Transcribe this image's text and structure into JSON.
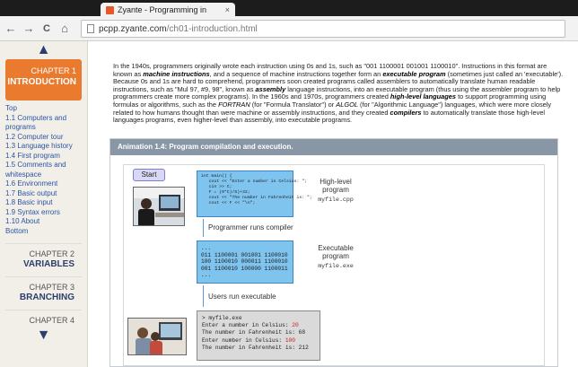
{
  "browser": {
    "tab_title": "Zyante - Programming in",
    "tab_close": "×",
    "back": "←",
    "forward": "→",
    "reload": "C",
    "home": "⌂",
    "url_host": "pcpp.zyante.com",
    "url_path": "/ch01-introduction.html"
  },
  "sidebar": {
    "up_arrow": "▲",
    "down_arrow": "▼",
    "active_chapter": {
      "label": "CHAPTER 1",
      "title": "INTRODUCTION"
    },
    "toc": [
      {
        "label": "Top",
        "sub": false
      },
      {
        "label": "1.1 Computers and programs",
        "sub": false
      },
      {
        "label": "1.2 Computer tour",
        "sub": false
      },
      {
        "label": "1.3 Language history",
        "sub": false
      },
      {
        "label": "1.4 First program",
        "sub": false
      },
      {
        "label": "1.5 Comments and whitespace",
        "sub": false
      },
      {
        "label": "1.6 Environment",
        "sub": false
      },
      {
        "label": "1.7 Basic output",
        "sub": false
      },
      {
        "label": "1.8 Basic input",
        "sub": false
      },
      {
        "label": "1.9 Syntax errors",
        "sub": false
      },
      {
        "label": "1.10 About",
        "sub": false
      },
      {
        "label": "Bottom",
        "sub": false
      }
    ],
    "chapters": [
      {
        "label": "CHAPTER 2",
        "title": "VARIABLES"
      },
      {
        "label": "CHAPTER 3",
        "title": "BRANCHING"
      },
      {
        "label": "CHAPTER 4",
        "title": ""
      }
    ]
  },
  "main": {
    "intro_segments": [
      {
        "t": "In the 1940s, programmers originally wrote each instruction using 0s and 1s, such as \"001 1100001 001001 1100010\". Instructions in this format are known as ",
        "s": ""
      },
      {
        "t": "machine instructions",
        "s": "bi"
      },
      {
        "t": ", and a sequence of machine instructions together form an ",
        "s": ""
      },
      {
        "t": "executable program",
        "s": "bi"
      },
      {
        "t": " (sometimes just called an 'executable'). Because 0s and 1s are hard to comprehend, programmers soon created programs called assemblers to automatically translate human readable instructions, such as \"Mul 97, #9, 98\", known as ",
        "s": ""
      },
      {
        "t": "assembly",
        "s": "bi"
      },
      {
        "t": " language instructions, into an executable program (thus using the assembler program to help programmers create more complex programs). In the 1960s and 1970s, programmers created ",
        "s": ""
      },
      {
        "t": "high-level languages",
        "s": "bi"
      },
      {
        "t": " to support programming using formulas or algorithms, such as the ",
        "s": ""
      },
      {
        "t": "FORTRAN",
        "s": "i"
      },
      {
        "t": " (for \"Formula Translator\") or ",
        "s": ""
      },
      {
        "t": "ALGOL",
        "s": "i"
      },
      {
        "t": " (for \"Algorithmic Language\") languages, which were more closely related to how humans thought than were machine or assembly instructions, and they created ",
        "s": ""
      },
      {
        "t": "compilers",
        "s": "bi"
      },
      {
        "t": " to automatically translate those high-level languages programs, even higher-level than assembly, into executable programs.",
        "s": ""
      }
    ],
    "animation": {
      "header": "Animation 1.4: Program compilation and execution.",
      "start_label": "Start",
      "source_lines": [
        "int main() {",
        "   cout << \"Enter a number in Celsius: \";",
        "   cin >> C;",
        "   F = (9*C)/5)+32;",
        "   cout << \"The number in Fahrenheit is: \";",
        "   cout << F << \"\\n\";"
      ],
      "step1": "Programmer runs compiler",
      "binary_lines": [
        "...",
        "011 1100001 001001 1100010",
        "100 1100010 000011 1100010",
        "001 1100010 100000 1100011",
        "..."
      ],
      "step2": "Users run executable",
      "run_lines": [
        {
          "text": "> myfile.exe",
          "value": ""
        },
        {
          "text": "Enter a number in Celsius: ",
          "value": "20"
        },
        {
          "text": "The number in Fahrenheit is: 68",
          "value": ""
        },
        {
          "text": "Enter number in Celsius: ",
          "value": "100"
        },
        {
          "text": "The number in Fahrenheit is: 212",
          "value": ""
        }
      ],
      "label_high": {
        "line1": "High-level",
        "line2": "program",
        "file": "myfile.cpp"
      },
      "label_exec": {
        "line1": "Executable",
        "line2": "program",
        "file": "myfile.exe"
      }
    }
  }
}
